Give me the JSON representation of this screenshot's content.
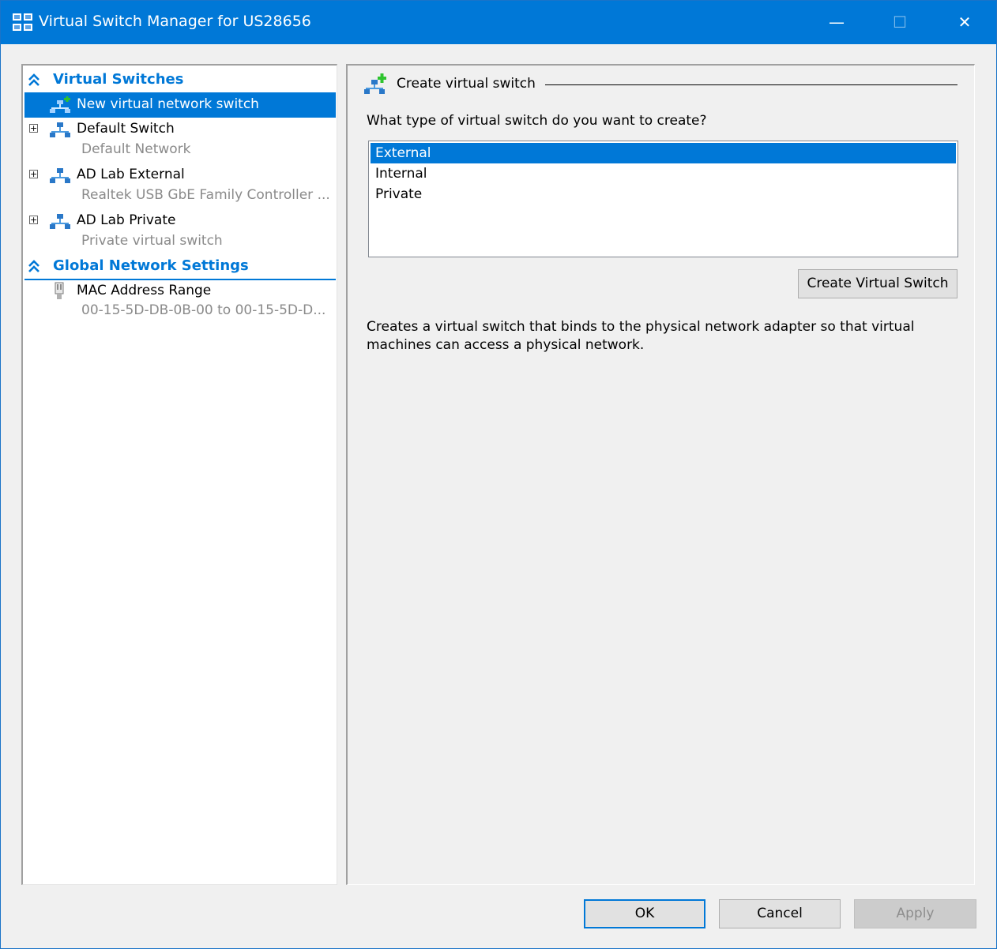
{
  "window": {
    "title": "Virtual Switch Manager for US28656",
    "icon": "virtual-switch-manager-icon",
    "controls": {
      "minimize": "—",
      "maximize": "☐",
      "close": "✕"
    }
  },
  "sidebar": {
    "sections": [
      {
        "label": "Virtual Switches",
        "collapse_icon": "double-chevron-up-icon",
        "items": [
          {
            "name": "New virtual network switch",
            "icon": "new-switch-icon",
            "selected": true
          },
          {
            "name": "Default Switch",
            "subtext": "Default Network",
            "icon": "network-switch-icon",
            "expander": "+"
          },
          {
            "name": "AD Lab External",
            "subtext": "Realtek USB GbE Family Controller ...",
            "icon": "network-switch-icon",
            "expander": "+"
          },
          {
            "name": "AD Lab Private",
            "subtext": "Private virtual switch",
            "icon": "network-switch-icon",
            "expander": "+"
          }
        ]
      },
      {
        "label": "Global Network Settings",
        "collapse_icon": "double-chevron-up-icon",
        "items": [
          {
            "name": "MAC Address Range",
            "subtext": "00-15-5D-DB-0B-00 to 00-15-5D-D...",
            "icon": "network-adapter-icon"
          }
        ]
      }
    ]
  },
  "main": {
    "group_title": "Create virtual switch",
    "question": "What type of virtual switch do you want to create?",
    "switch_types": [
      "External",
      "Internal",
      "Private"
    ],
    "selected_type": "External",
    "create_button": "Create Virtual Switch",
    "description": "Creates a virtual switch that binds to the physical network adapter so that virtual machines can access a physical network."
  },
  "footer": {
    "ok": "OK",
    "cancel": "Cancel",
    "apply": "Apply"
  },
  "colors": {
    "accent": "#0078d7",
    "disabled_text": "#8d8d8d",
    "subtext": "#8a8a8a"
  }
}
